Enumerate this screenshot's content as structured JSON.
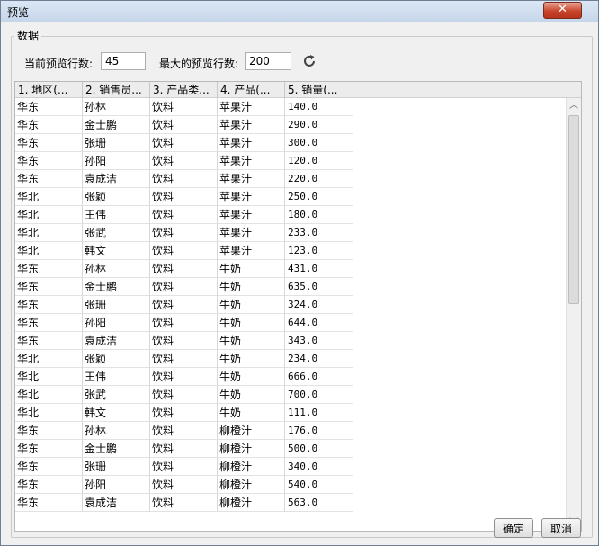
{
  "window": {
    "title": "预览",
    "close_glyph": "✕"
  },
  "group": {
    "title": "数据",
    "current_rows_label": "当前预览行数:",
    "current_rows_value": "45",
    "max_rows_label": "最大的预览行数:",
    "max_rows_value": "200",
    "refresh_icon": "refresh-icon"
  },
  "table": {
    "columns": [
      "1. 地区(...",
      "2. 销售员...",
      "3. 产品类...",
      "4. 产品(...",
      "5. 销量(..."
    ],
    "rows": [
      [
        "华东",
        "孙林",
        "饮料",
        "苹果汁",
        "140.0"
      ],
      [
        "华东",
        "金士鹏",
        "饮料",
        "苹果汁",
        "290.0"
      ],
      [
        "华东",
        "张珊",
        "饮料",
        "苹果汁",
        "300.0"
      ],
      [
        "华东",
        "孙阳",
        "饮料",
        "苹果汁",
        "120.0"
      ],
      [
        "华东",
        "袁成洁",
        "饮料",
        "苹果汁",
        "220.0"
      ],
      [
        "华北",
        "张颖",
        "饮料",
        "苹果汁",
        "250.0"
      ],
      [
        "华北",
        "王伟",
        "饮料",
        "苹果汁",
        "180.0"
      ],
      [
        "华北",
        "张武",
        "饮料",
        "苹果汁",
        "233.0"
      ],
      [
        "华北",
        "韩文",
        "饮料",
        "苹果汁",
        "123.0"
      ],
      [
        "华东",
        "孙林",
        "饮料",
        "牛奶",
        "431.0"
      ],
      [
        "华东",
        "金士鹏",
        "饮料",
        "牛奶",
        "635.0"
      ],
      [
        "华东",
        "张珊",
        "饮料",
        "牛奶",
        "324.0"
      ],
      [
        "华东",
        "孙阳",
        "饮料",
        "牛奶",
        "644.0"
      ],
      [
        "华东",
        "袁成洁",
        "饮料",
        "牛奶",
        "343.0"
      ],
      [
        "华北",
        "张颖",
        "饮料",
        "牛奶",
        "234.0"
      ],
      [
        "华北",
        "王伟",
        "饮料",
        "牛奶",
        "666.0"
      ],
      [
        "华北",
        "张武",
        "饮料",
        "牛奶",
        "700.0"
      ],
      [
        "华北",
        "韩文",
        "饮料",
        "牛奶",
        "111.0"
      ],
      [
        "华东",
        "孙林",
        "饮料",
        "柳橙汁",
        "176.0"
      ],
      [
        "华东",
        "金士鹏",
        "饮料",
        "柳橙汁",
        "500.0"
      ],
      [
        "华东",
        "张珊",
        "饮料",
        "柳橙汁",
        "340.0"
      ],
      [
        "华东",
        "孙阳",
        "饮料",
        "柳橙汁",
        "540.0"
      ],
      [
        "华东",
        "袁成洁",
        "饮料",
        "柳橙汁",
        "563.0"
      ]
    ]
  },
  "scrollbar": {
    "up_glyph": "︿",
    "down_glyph": "﹀"
  },
  "buttons": {
    "ok": "确定",
    "cancel": "取消"
  }
}
